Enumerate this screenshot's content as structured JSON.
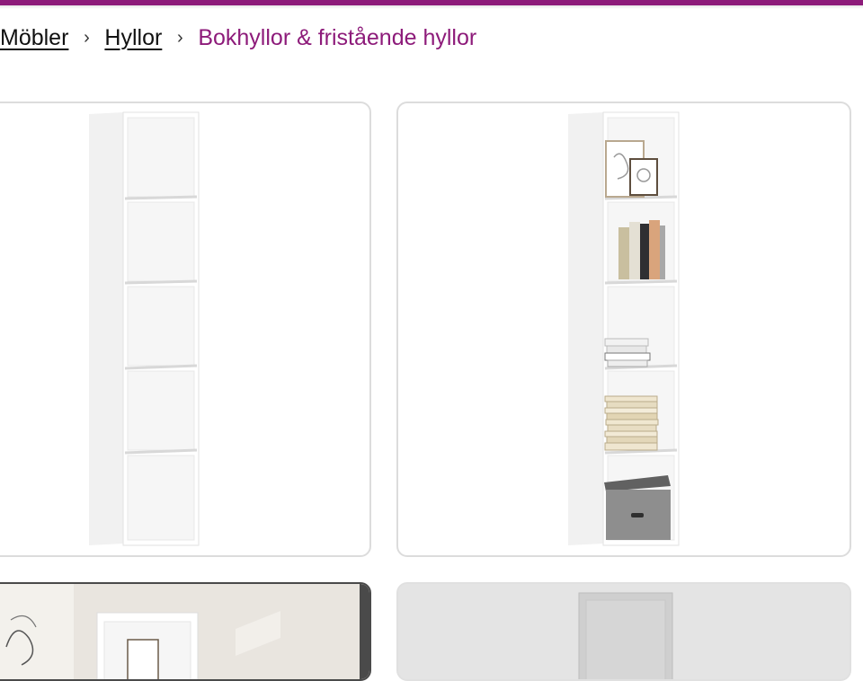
{
  "brand": {
    "accent": "#8d1b7a"
  },
  "breadcrumb": {
    "items": [
      {
        "label": "Möbler"
      },
      {
        "label": "Hyllor"
      }
    ],
    "separator": "›",
    "current": "Bokhyllor & fristående hyllor"
  },
  "products": [
    {
      "image": "white-bookcase-empty"
    },
    {
      "image": "white-bookcase-styled"
    },
    {
      "image": "white-shelf-lifestyle"
    },
    {
      "image": "white-shelf-grey-background"
    }
  ]
}
